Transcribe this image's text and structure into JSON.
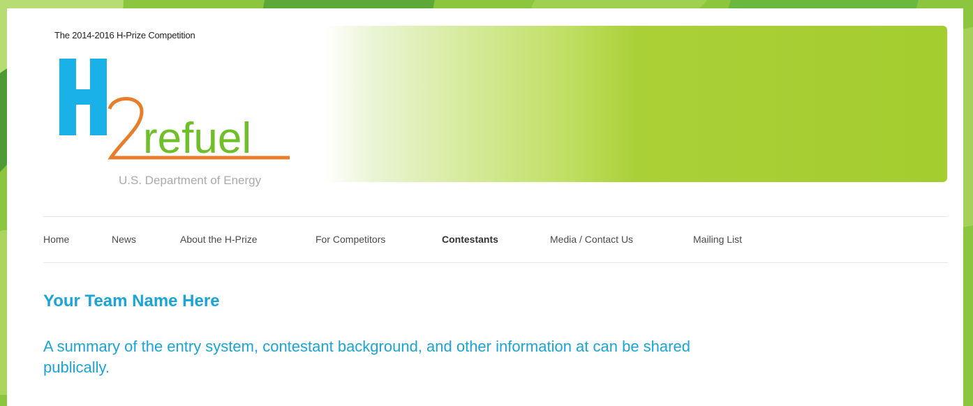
{
  "header": {
    "tagline": "The 2014-2016 H-Prize Competition",
    "logo": {
      "big_letter": "H",
      "numeral": "2",
      "wordmark": "refuel",
      "org": "U.S. Department of Energy",
      "colors": {
        "h": "#1ab0e8",
        "two": "#e87d2b",
        "wordmark": "#6fbf2a",
        "org": "#aaaaaa"
      }
    },
    "banner_color": "#a4cd30"
  },
  "nav": {
    "items": [
      {
        "label": "Home",
        "active": false
      },
      {
        "label": "News",
        "active": false
      },
      {
        "label": "About the H-Prize",
        "active": false
      },
      {
        "label": "For Competitors",
        "active": false
      },
      {
        "label": "Contestants",
        "active": true
      },
      {
        "label": "Media / Contact Us",
        "active": false
      },
      {
        "label": "Mailing List",
        "active": false
      }
    ]
  },
  "content": {
    "title": "Your Team Name Here",
    "summary": "A summary of the entry system, contestant background, and other information at can be shared publically."
  },
  "colors": {
    "accent": "#1aa4d8",
    "page_background": "#8cc63f"
  }
}
